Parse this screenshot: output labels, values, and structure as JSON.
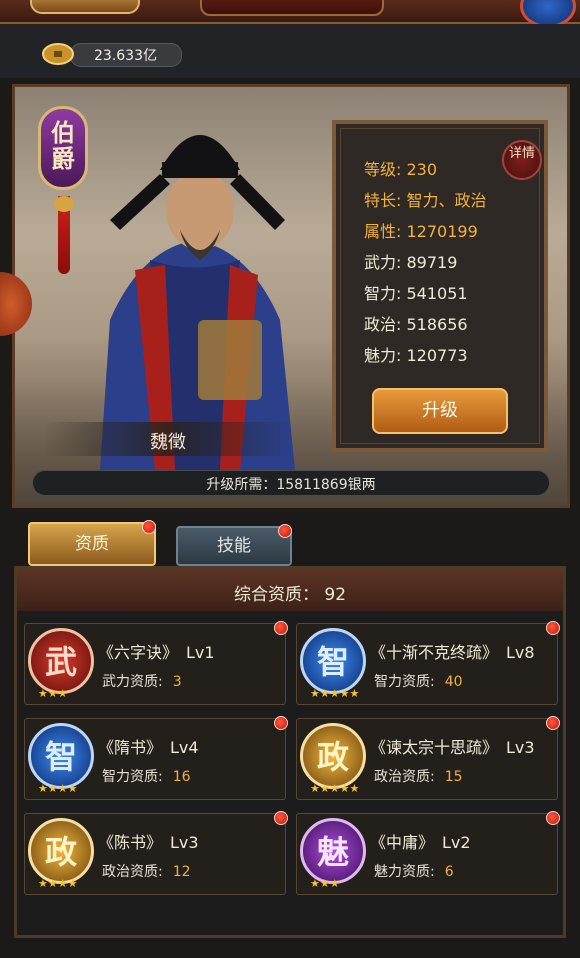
{
  "currency": {
    "amount": "23.633亿"
  },
  "rank_badge": "伯爵",
  "character": {
    "name": "魏徵"
  },
  "stats": {
    "level_label": "等级:",
    "level": "230",
    "specialty_label": "特长:",
    "specialty": "智力、政治",
    "attribute_label": "属性:",
    "attribute": "1270199",
    "force_label": "武力:",
    "force": "89719",
    "intellect_label": "智力:",
    "intellect": "541051",
    "politics_label": "政治:",
    "politics": "518656",
    "charm_label": "魅力:",
    "charm": "120773"
  },
  "detail_button": "详情",
  "upgrade_button": "升级",
  "upgrade_cost": "升级所需：15811869银两",
  "tabs": {
    "quality": "资质",
    "skills": "技能"
  },
  "quality_title": "综合资质：  92",
  "skills": [
    {
      "icon_char": "武",
      "name": "《六字诀》",
      "level": "Lv1",
      "attr": "武力资质:",
      "value": "3",
      "stars": "★★★",
      "color": "red"
    },
    {
      "icon_char": "智",
      "name": "《十渐不克终疏》",
      "level": "Lv8",
      "attr": "智力资质:",
      "value": "40",
      "stars": "★★★★★",
      "color": "blue"
    },
    {
      "icon_char": "智",
      "name": "《隋书》",
      "level": "Lv4",
      "attr": "智力资质:",
      "value": "16",
      "stars": "★★★★",
      "color": "blue"
    },
    {
      "icon_char": "政",
      "name": "《谏太宗十思疏》",
      "level": "Lv3",
      "attr": "政治资质:",
      "value": "15",
      "stars": "★★★★★",
      "color": "gold"
    },
    {
      "icon_char": "政",
      "name": "《陈书》",
      "level": "Lv3",
      "attr": "政治资质:",
      "value": "12",
      "stars": "★★★★",
      "color": "gold"
    },
    {
      "icon_char": "魅",
      "name": "《中庸》",
      "level": "Lv2",
      "attr": "魅力资质:",
      "value": "6",
      "stars": "★★★",
      "color": "purple"
    }
  ]
}
